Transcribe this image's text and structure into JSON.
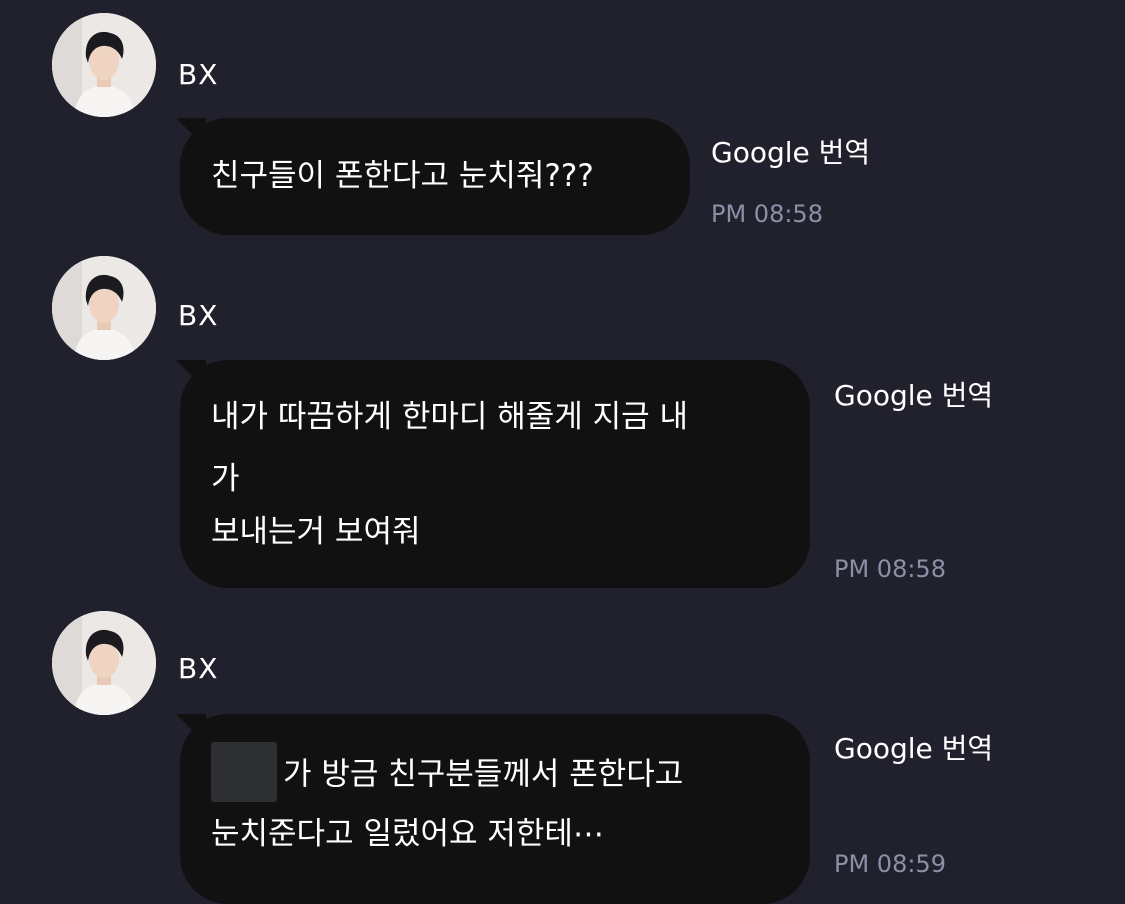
{
  "messages": [
    {
      "sender": "BX",
      "lines": [
        "친구들이 폰한다고 눈치줘???"
      ],
      "translate_label": "Google 번역",
      "time": "PM 08:58"
    },
    {
      "sender": "BX",
      "lines": [
        "내가 따끔하게 한마디 해줄게 지금 내",
        "가",
        "보내는거 보여줘"
      ],
      "translate_label": "Google 번역",
      "time": "PM 08:58"
    },
    {
      "sender": "BX",
      "lines": [
        "가 방금 친구분들께서 폰한다고",
        "눈치준다고 일렀어요 저한테⋯"
      ],
      "translate_label": "Google 번역",
      "time": "PM 08:59"
    }
  ],
  "colors": {
    "background": "#20212c",
    "bubble": "#111111",
    "text": "#ffffff",
    "time": "#8e8ea6"
  }
}
